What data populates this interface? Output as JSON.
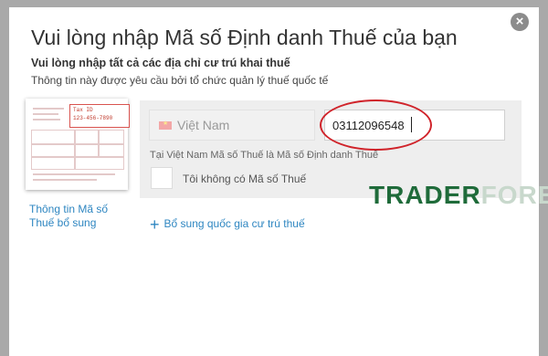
{
  "dialog": {
    "title": "Vui lòng nhập Mã số Định danh Thuế của bạn",
    "subtitle": "Vui lòng nhập tất cả các địa chỉ cư trú khai thuế",
    "info": "Thông tin này được yêu cầu bởi tổ chức quản lý thuế quốc tế",
    "close_icon": "×"
  },
  "thumbnail": {
    "tax_id_label": "Tax ID",
    "tax_id_value": "123-456-7890"
  },
  "tax_info_link": {
    "line1": "Thông tin Mã số",
    "line2": "Thuế bổ sung"
  },
  "residence": {
    "country": "Việt Nam",
    "tin_value": "03112096548",
    "hint": "Tại Việt Nam Mã số Thuế là Mã số Định danh Thuế",
    "no_tin_label": "Tôi không có Mã số Thuế"
  },
  "add_country": {
    "plus": "+",
    "label": "Bổ sung quốc gia cư trú thuế"
  },
  "watermark": {
    "part1": "TRADER",
    "part2": "FOREX"
  },
  "colors": {
    "link": "#2e86c1",
    "highlight": "#d0232a",
    "watermark_green": "#1f6b3a"
  }
}
